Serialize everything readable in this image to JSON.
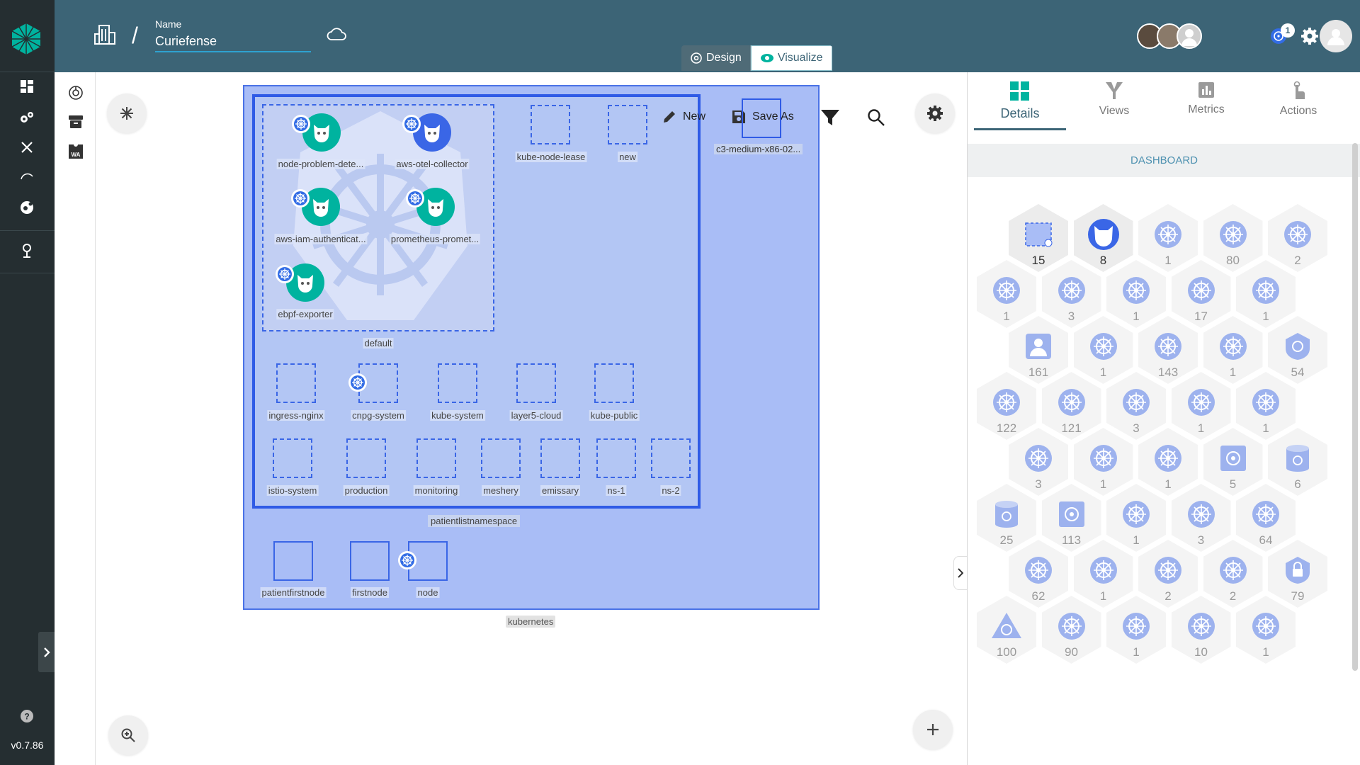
{
  "header": {
    "name_label": "Name",
    "name_value": "Curiefense",
    "toggle": {
      "design_label": "Design",
      "visualize_label": "Visualize"
    },
    "notification_badge": "1"
  },
  "sidebar": {
    "version": "v0.7.86"
  },
  "canvas": {
    "toolbar": {
      "new_label": "New",
      "save_as_label": "Save As"
    },
    "kubernetes_label": "kubernetes",
    "patient_ns_label": "patientlistnamespace",
    "default_ns_label": "default",
    "machine_label": "c3-medium-x86-02...",
    "pods": [
      {
        "label": "node-problem-dete...",
        "color": "#00b39f"
      },
      {
        "label": "aws-otel-collector",
        "color": "#3a66e6"
      },
      {
        "label": "aws-iam-authenticat...",
        "color": "#00b39f"
      },
      {
        "label": "prometheus-promet...",
        "color": "#00b39f"
      },
      {
        "label": "ebpf-exporter",
        "color": "#00b39f"
      }
    ],
    "top_namespaces": [
      "kube-node-lease",
      "new"
    ],
    "namespaces_row1": [
      "ingress-nginx",
      "cnpg-system",
      "kube-system",
      "layer5-cloud",
      "kube-public"
    ],
    "namespaces_row2": [
      "istio-system",
      "production",
      "monitoring",
      "meshery",
      "emissary",
      "ns-1",
      "ns-2"
    ],
    "nodes": [
      "patientfirstnode",
      "firstnode",
      "node"
    ]
  },
  "panel": {
    "tabs": [
      {
        "label": "Details",
        "active": true
      },
      {
        "label": "Views",
        "active": false
      },
      {
        "label": "Metrics",
        "active": false
      },
      {
        "label": "Actions",
        "active": false
      }
    ],
    "dashboard_label": "DASHBOARD",
    "hex_rows": [
      [
        {
          "c": "15",
          "t": "ns"
        },
        {
          "c": "8",
          "t": "pod"
        },
        {
          "c": "1",
          "t": "k8s"
        },
        {
          "c": "80",
          "t": "k8s"
        },
        {
          "c": "2",
          "t": "k8s"
        }
      ],
      [
        {
          "c": "1",
          "t": "k8s"
        },
        {
          "c": "3",
          "t": "k8s"
        },
        {
          "c": "1",
          "t": "k8s"
        },
        {
          "c": "17",
          "t": "k8s"
        },
        {
          "c": "1",
          "t": "k8s"
        }
      ],
      [
        {
          "c": "161",
          "t": "user"
        },
        {
          "c": "1",
          "t": "k8s"
        },
        {
          "c": "143",
          "t": "k8s"
        },
        {
          "c": "1",
          "t": "k8s"
        },
        {
          "c": "54",
          "t": "shield"
        }
      ],
      [
        {
          "c": "122",
          "t": "k8s"
        },
        {
          "c": "121",
          "t": "k8s"
        },
        {
          "c": "3",
          "t": "k8s"
        },
        {
          "c": "1",
          "t": "k8s"
        },
        {
          "c": "1",
          "t": "k8s"
        }
      ],
      [
        {
          "c": "3",
          "t": "k8s"
        },
        {
          "c": "1",
          "t": "k8s"
        },
        {
          "c": "1",
          "t": "k8s"
        },
        {
          "c": "5",
          "t": "square"
        },
        {
          "c": "6",
          "t": "db"
        }
      ],
      [
        {
          "c": "25",
          "t": "db"
        },
        {
          "c": "113",
          "t": "square"
        },
        {
          "c": "1",
          "t": "k8s"
        },
        {
          "c": "3",
          "t": "k8s"
        },
        {
          "c": "64",
          "t": "k8s"
        }
      ],
      [
        {
          "c": "62",
          "t": "k8s"
        },
        {
          "c": "1",
          "t": "k8s"
        },
        {
          "c": "2",
          "t": "k8s"
        },
        {
          "c": "2",
          "t": "k8s"
        },
        {
          "c": "79",
          "t": "lock"
        }
      ],
      [
        {
          "c": "100",
          "t": "tri"
        },
        {
          "c": "90",
          "t": "k8s"
        },
        {
          "c": "1",
          "t": "k8s"
        },
        {
          "c": "10",
          "t": "k8s"
        },
        {
          "c": "1",
          "t": "k8s"
        }
      ]
    ]
  },
  "colors": {
    "header": "#3c6476",
    "rail": "#252e31",
    "accent": "#00b39f",
    "k8s_blue": "#3a66e6"
  }
}
